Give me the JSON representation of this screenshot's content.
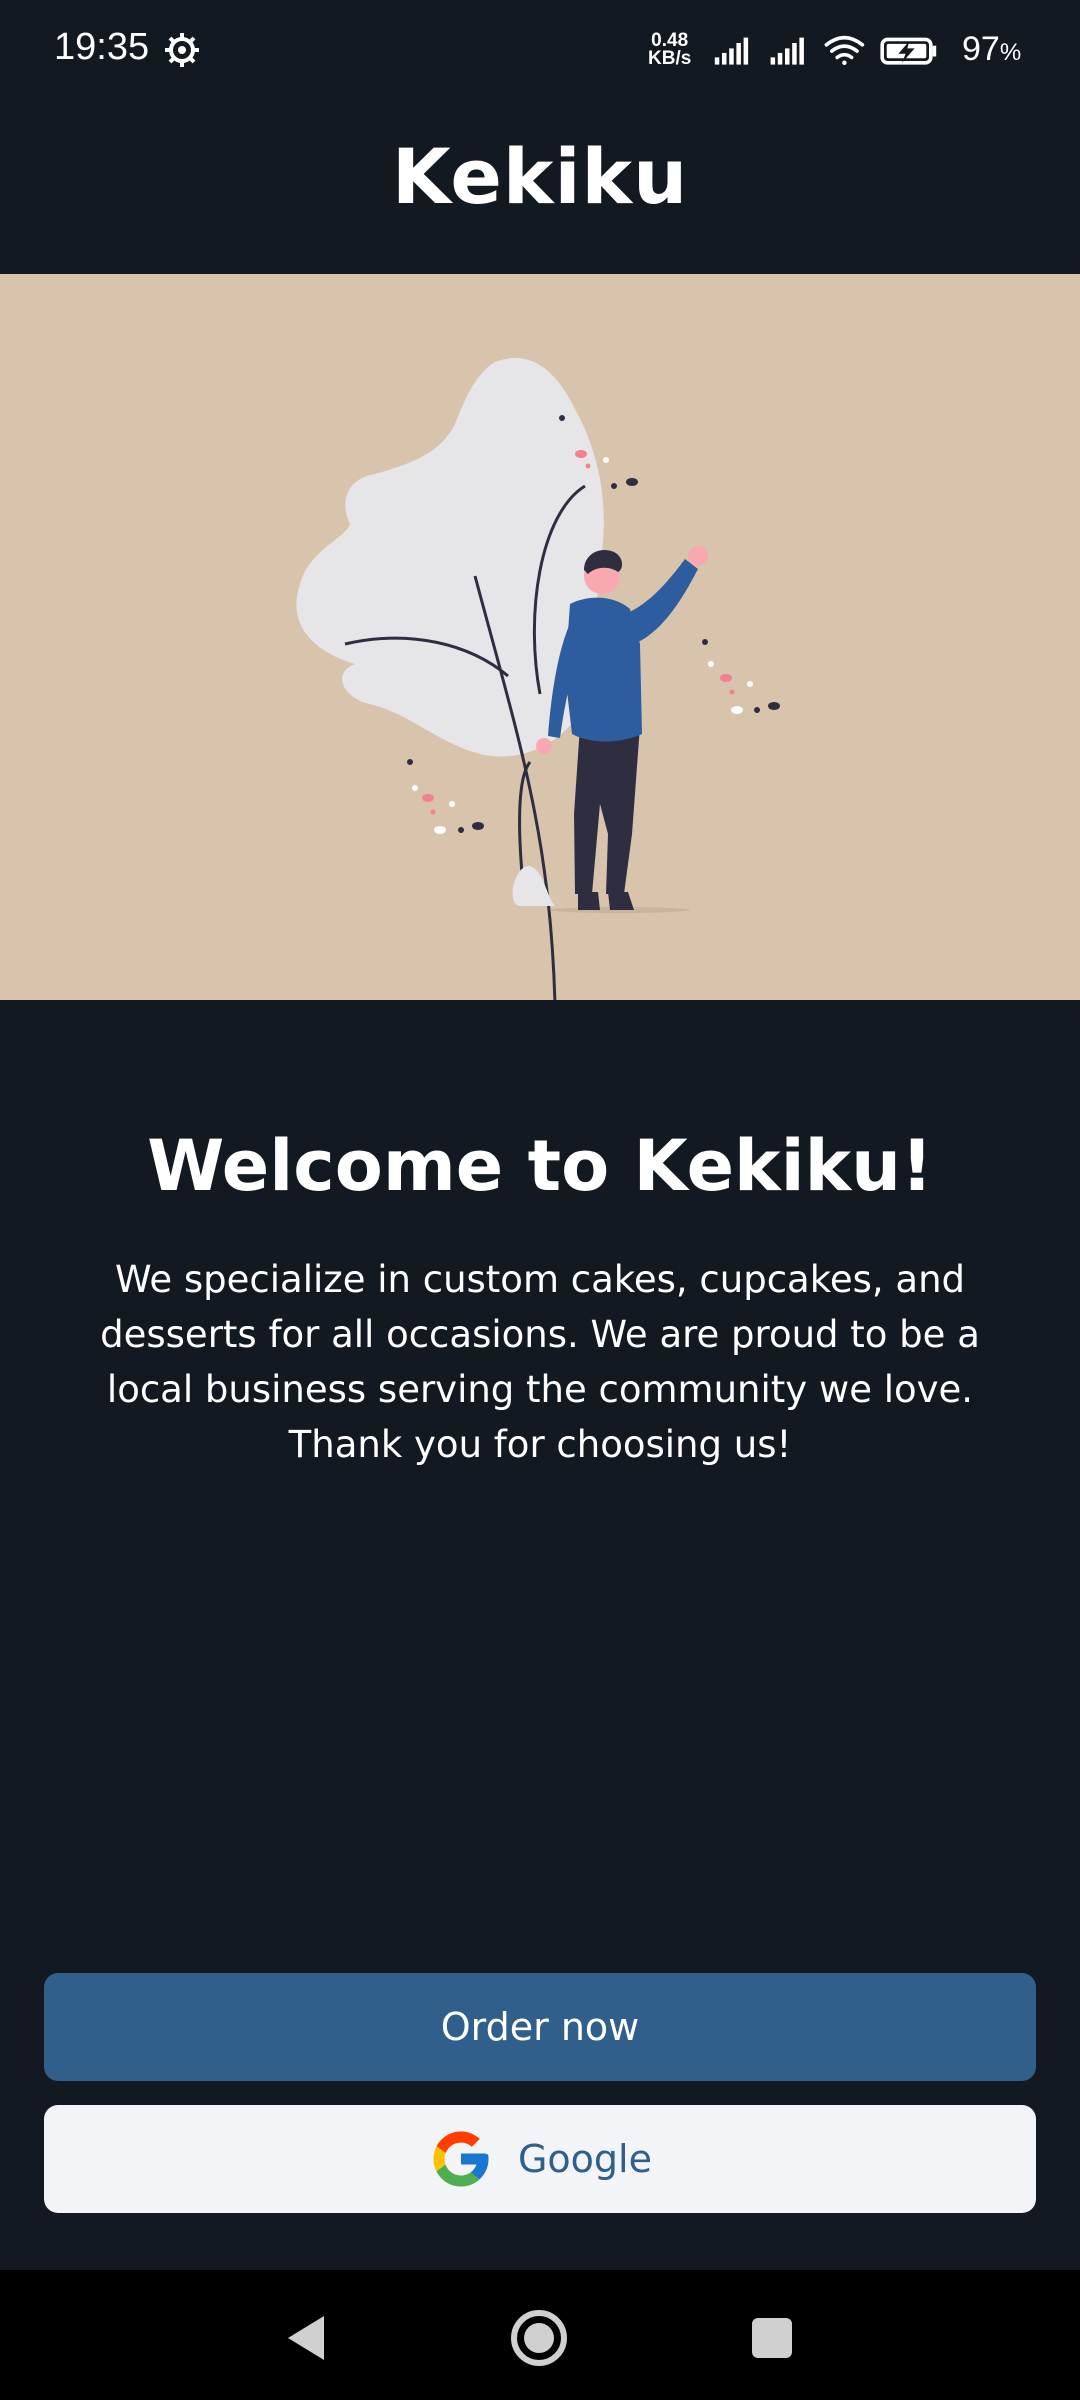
{
  "status_bar": {
    "time": "19:35",
    "network_speed_value": "0.48",
    "network_speed_unit": "KB/s",
    "battery_percent": "97",
    "battery_percent_sign": "%",
    "icons": [
      "settings-gear-icon",
      "signal-icon",
      "signal-icon",
      "wifi-icon",
      "battery-charging-icon"
    ]
  },
  "header": {
    "title": "Kekiku"
  },
  "hero": {
    "illustration": "person-waving-leaf-illustration",
    "background_color": "#d8c4ad"
  },
  "welcome": {
    "title": "Welcome to Kekiku!",
    "body": "We specialize in custom cakes, cupcakes, and desserts for all occasions. We are proud to be a local business serving the community we love. Thank you for choosing us!"
  },
  "actions": {
    "order_label": "Order now",
    "google_label": "Google"
  },
  "nav_bar": {
    "icons": [
      "back-icon",
      "home-icon",
      "recents-icon"
    ]
  },
  "colors": {
    "background": "#131920",
    "primary": "#2f5f8a",
    "secondary_button": "#f2f4f8"
  }
}
